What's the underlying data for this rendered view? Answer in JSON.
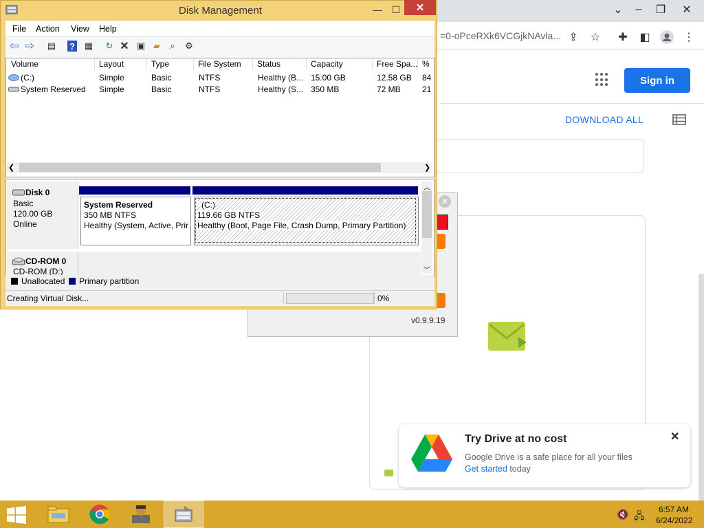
{
  "browser": {
    "url_fragment": "=0-oPceRXk6VCGjkNAvla...",
    "sign_in_label": "Sign in",
    "download_all_label": "DOWNLOAD ALL"
  },
  "popup": {
    "version": "v0.9.9.19"
  },
  "promo": {
    "title": "Try Drive at no cost",
    "description": "Google Drive is a safe place for all your files",
    "link_label": "Get started",
    "link_suffix": " today"
  },
  "disk_management": {
    "title": "Disk Management",
    "menu": [
      "File",
      "Action",
      "View",
      "Help"
    ],
    "columns": [
      "Volume",
      "Layout",
      "Type",
      "File System",
      "Status",
      "Capacity",
      "Free Spa...",
      "% F"
    ],
    "volumes": [
      {
        "volume": "(C:)",
        "layout": "Simple",
        "type": "Basic",
        "fs": "NTFS",
        "status": "Healthy (B...",
        "capacity": "15.00 GB",
        "free": "12.58 GB",
        "pct": "84"
      },
      {
        "volume": "System Reserved",
        "layout": "Simple",
        "type": "Basic",
        "fs": "NTFS",
        "status": "Healthy (S...",
        "capacity": "350 MB",
        "free": "72 MB",
        "pct": "21"
      }
    ],
    "disk0": {
      "name": "Disk 0",
      "type": "Basic",
      "size": "120.00 GB",
      "state": "Online"
    },
    "partitions": {
      "system_reserved": {
        "name": "System Reserved",
        "size": "350 MB NTFS",
        "status": "Healthy (System, Active, Prir"
      },
      "c": {
        "name": "(C:)",
        "size": "119.66 GB NTFS",
        "status": "Healthy (Boot, Page File, Crash Dump, Primary Partition)"
      }
    },
    "cdrom": {
      "name": "CD-ROM 0",
      "drive": "CD-ROM (D:)"
    },
    "legend": {
      "unallocated": "Unallocated",
      "primary": "Primary partition",
      "unallocated_color": "#000000",
      "primary_color": "#000080"
    },
    "status": {
      "text": "Creating Virtual Disk...",
      "progress_pct_label": "0%",
      "progress": 0
    }
  },
  "taskbar": {
    "time": "6:57 AM",
    "date": "6/24/2022"
  }
}
